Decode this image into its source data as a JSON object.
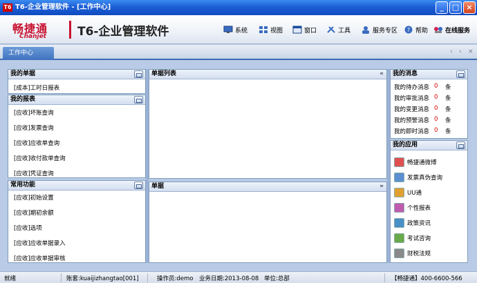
{
  "window": {
    "title": "T6-企业管理软件 - [工作中心]",
    "logo_text": "T6",
    "min_label": "_",
    "max_label": "□",
    "close_label": "×"
  },
  "banner": {
    "brand": "畅捷通",
    "brand_sub": "Chanjet",
    "product": "T6-企业管理软件",
    "menu": [
      {
        "label": "系统",
        "icon": "monitor-icon"
      },
      {
        "label": "视图",
        "icon": "grid-icon"
      },
      {
        "label": "窗口",
        "icon": "window-icon"
      },
      {
        "label": "工具",
        "icon": "tools-icon"
      },
      {
        "label": "服务专区",
        "icon": "user-service-icon"
      },
      {
        "label": "帮助",
        "icon": "help-icon"
      },
      {
        "label": "在线服务",
        "icon": "online-service-icon"
      }
    ]
  },
  "tabbar": {
    "active_tab": "工作中心",
    "prev": "‹",
    "next": "›",
    "close": "×"
  },
  "panels": {
    "my_docs": {
      "title": "我的单据",
      "items": [
        "[成本]工时日报表"
      ]
    },
    "my_reports": {
      "title": "我的报表",
      "items": [
        "[应收]坏账查询",
        "[应收]发票查询",
        "[应收]应收单查询",
        "[应收]收付款单查询",
        "[应收]凭证查询"
      ]
    },
    "common": {
      "title": "常用功能",
      "items": [
        "[应收]初始设置",
        "[应收]期初余额",
        "[应收]选项",
        "[应收]应收单据录入",
        "[应收]应收单据审核"
      ]
    },
    "doc_list": {
      "title": "单据列表",
      "chev": "«"
    },
    "doc": {
      "title": "单据",
      "chev": "»"
    },
    "messages": {
      "title": "我的消息",
      "rows": [
        {
          "label": "我的待办消息",
          "count": "0",
          "unit": "条"
        },
        {
          "label": "我的审批消息",
          "count": "0",
          "unit": "条"
        },
        {
          "label": "我的变更消息",
          "count": "0",
          "unit": "条"
        },
        {
          "label": "我的预警消息",
          "count": "0",
          "unit": "条"
        },
        {
          "label": "我的即时消息",
          "count": "0",
          "unit": "条"
        }
      ]
    },
    "apps": {
      "title": "我的应用",
      "items": [
        {
          "label": "畅捷通微博",
          "icon": "weibo-icon",
          "color": "#e05050"
        },
        {
          "label": "发票真伪查询",
          "icon": "invoice-search-icon",
          "color": "#5a8fd0"
        },
        {
          "label": "UU通",
          "icon": "uu-chat-icon",
          "color": "#e0a030"
        },
        {
          "label": "个性报表",
          "icon": "report-icon",
          "color": "#c05cb0"
        },
        {
          "label": "政策资讯",
          "icon": "news-icon",
          "color": "#4a90c8"
        },
        {
          "label": "考试咨询",
          "icon": "exam-icon",
          "color": "#6aaa4a"
        },
        {
          "label": "财税法规",
          "icon": "law-book-icon",
          "color": "#8a8a8a"
        }
      ]
    }
  },
  "status": {
    "state": "就绪",
    "account": "账套:kuaijizhangtao[001]",
    "operator": "操作员:demo",
    "date": "业务日期:2013-08-08",
    "unit": "单位:总部",
    "hotline": "【畅捷通】400-6600-566"
  }
}
